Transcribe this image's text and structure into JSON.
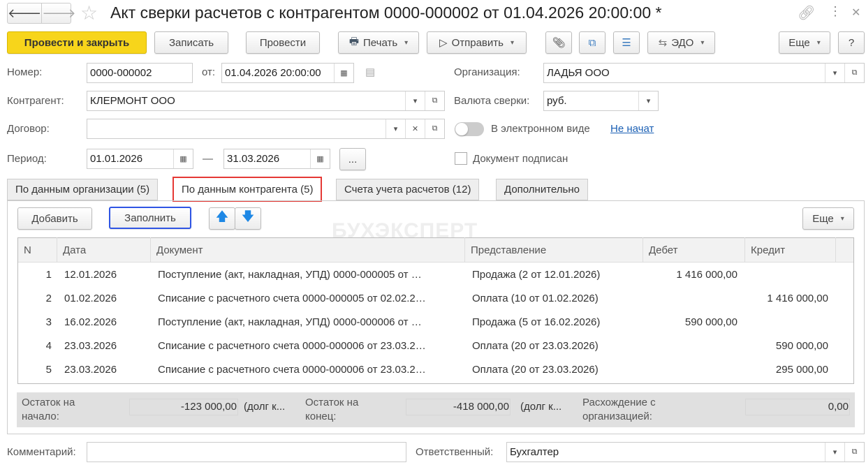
{
  "window": {
    "title": "Акт сверки расчетов с контрагентом 0000-000002 от 01.04.2026 20:00:00 *"
  },
  "toolbar": {
    "post_close": "Провести и закрыть",
    "save": "Записать",
    "post": "Провести",
    "print": "Печать",
    "send": "Отправить",
    "edo": "ЭДО",
    "more": "Еще",
    "help": "?"
  },
  "form": {
    "number_label": "Номер:",
    "number": "0000-000002",
    "date_label": "от:",
    "date": "01.04.2026 20:00:00",
    "org_label": "Организация:",
    "org": "ЛАДЬЯ ООО",
    "contractor_label": "Контрагент:",
    "contractor": "КЛЕРМОНТ ООО",
    "currency_label": "Валюта сверки:",
    "currency": "руб.",
    "contract_label": "Договор:",
    "contract": "",
    "electronic_label": "В электронном виде",
    "electronic_status": "Не начат",
    "period_label": "Период:",
    "period_from": "01.01.2026",
    "period_dash": "—",
    "period_to": "31.03.2026",
    "period_btn": "...",
    "signed_label": "Документ подписан"
  },
  "tabs": [
    {
      "label": "По данным организации (5)"
    },
    {
      "label": "По данным контрагента (5)"
    },
    {
      "label": "Счета учета расчетов (12)"
    },
    {
      "label": "Дополнительно"
    }
  ],
  "table_toolbar": {
    "add": "Добавить",
    "fill": "Заполнить",
    "more": "Еще"
  },
  "watermark": "БУХЭКСПЕРТ",
  "table": {
    "columns": [
      "N",
      "Дата",
      "Документ",
      "Представление",
      "Дебет",
      "Кредит"
    ],
    "rows": [
      {
        "n": "1",
        "date": "12.01.2026",
        "doc": "Поступление (акт, накладная, УПД) 0000-000005 от …",
        "repr": "Продажа (2 от 12.01.2026)",
        "debit": "1 416 000,00",
        "credit": ""
      },
      {
        "n": "2",
        "date": "01.02.2026",
        "doc": "Списание с расчетного счета 0000-000005 от 02.02.2…",
        "repr": "Оплата (10 от 01.02.2026)",
        "debit": "",
        "credit": "1 416 000,00"
      },
      {
        "n": "3",
        "date": "16.02.2026",
        "doc": "Поступление (акт, накладная, УПД) 0000-000006 от …",
        "repr": "Продажа (5 от 16.02.2026)",
        "debit": "590 000,00",
        "credit": ""
      },
      {
        "n": "4",
        "date": "23.03.2026",
        "doc": "Списание с расчетного счета 0000-000006 от 23.03.2…",
        "repr": "Оплата (20 от 23.03.2026)",
        "debit": "",
        "credit": "590 000,00"
      },
      {
        "n": "5",
        "date": "23.03.2026",
        "doc": "Списание с расчетного счета 0000-000006 от 23.03.2…",
        "repr": "Оплата (20 от 23.03.2026)",
        "debit": "",
        "credit": "295 000,00"
      }
    ]
  },
  "totals": {
    "start_label": "Остаток на начало:",
    "start": "-123 000,00",
    "start_note": "(долг к...",
    "end_label": "Остаток на конец:",
    "end": "-418 000,00",
    "end_note": "(долг к...",
    "diff_label": "Расхождение с организацией:",
    "diff": "0,00"
  },
  "footer": {
    "comment_label": "Комментарий:",
    "comment": "",
    "responsible_label": "Ответственный:",
    "responsible": "Бухгалтер"
  }
}
